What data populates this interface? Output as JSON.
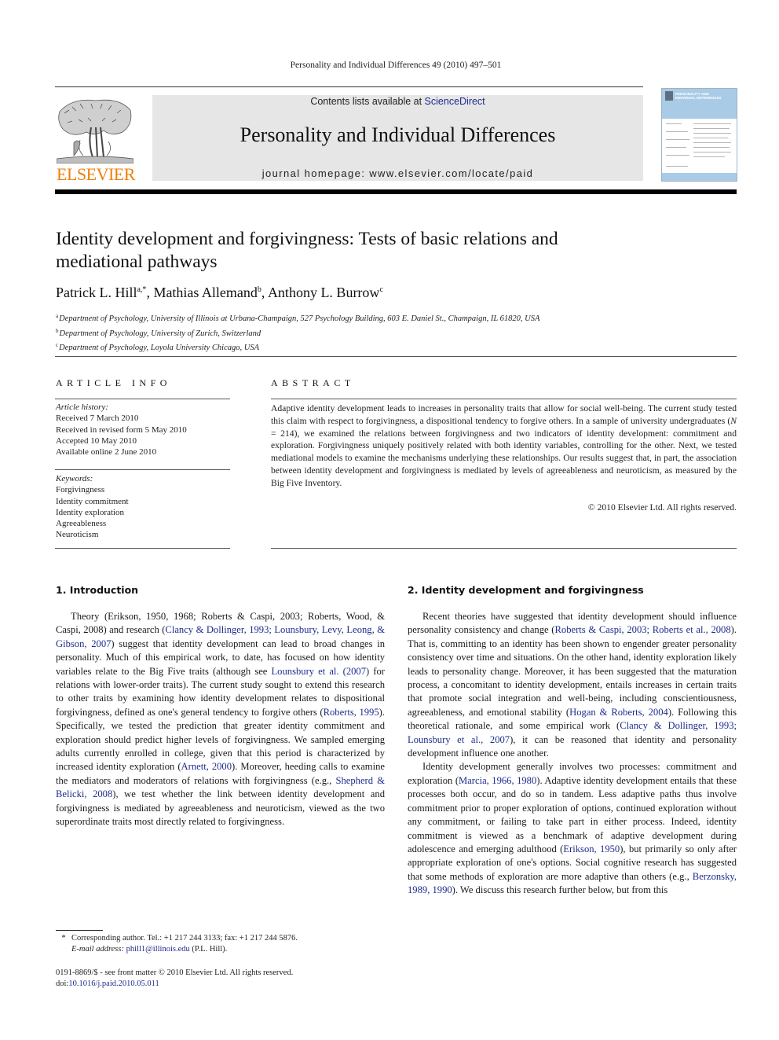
{
  "header": {
    "journal_reference": "Personality and Individual Differences 49 (2010) 497–501",
    "contents_prefix": "Contents lists available at ",
    "contents_link": "ScienceDirect",
    "journal_title": "Personality and Individual Differences",
    "homepage": "journal homepage: www.elsevier.com/locate/paid",
    "publisher_logo_text": "ELSEVIER",
    "cover_title_line1": "PERSONALITY AND",
    "cover_title_line2": "INDIVIDUAL DIFFERENCES"
  },
  "article": {
    "title": "Identity development and forgivingness: Tests of basic relations and mediational pathways",
    "authors": [
      {
        "name": "Patrick L. Hill",
        "marks": "a,*"
      },
      {
        "name": "Mathias Allemand",
        "marks": "b"
      },
      {
        "name": "Anthony L. Burrow",
        "marks": "c"
      }
    ],
    "affiliations": [
      {
        "mark": "a",
        "text": "Department of Psychology, University of Illinois at Urbana-Champaign, 527 Psychology Building, 603 E. Daniel St., Champaign, IL 61820, USA"
      },
      {
        "mark": "b",
        "text": "Department of Psychology, University of Zurich, Switzerland"
      },
      {
        "mark": "c",
        "text": "Department of Psychology, Loyola University Chicago, USA"
      }
    ]
  },
  "article_info": {
    "heading": "ARTICLE INFO",
    "history_label": "Article history:",
    "history": [
      "Received 7 March 2010",
      "Received in revised form 5 May 2010",
      "Accepted 10 May 2010",
      "Available online 2 June 2010"
    ],
    "keywords_label": "Keywords:",
    "keywords": [
      "Forgivingness",
      "Identity commitment",
      "Identity exploration",
      "Agreeableness",
      "Neuroticism"
    ]
  },
  "abstract": {
    "heading": "ABSTRACT",
    "text_1": "Adaptive identity development leads to increases in personality traits that allow for social well-being. The current study tested this claim with respect to forgivingness, a dispositional tendency to forgive others. In a sample of university undergraduates (",
    "n_label": "N",
    "text_2": " = 214), we examined the relations between forgivingness and two indicators of identity development: commitment and exploration. Forgivingness uniquely positively related with both identity variables, controlling for the other. Next, we tested mediational models to examine the mechanisms underlying these relationships. Our results suggest that, in part, the association between identity development and forgivingness is mediated by levels of agreeableness and neuroticism, as measured by the Big Five Inventory.",
    "copyright": "© 2010 Elsevier Ltd. All rights reserved."
  },
  "sections": {
    "intro": {
      "heading": "1. Introduction",
      "p1": [
        {
          "t": "Theory (Erikson, 1950, 1968; Roberts & Caspi, 2003; Roberts, Wood, & Caspi, 2008) and research ("
        },
        {
          "t": "Clancy & Dollinger, 1993; Lounsbury, Levy, Leong, & Gibson, 2007",
          "cite": true
        },
        {
          "t": ") suggest that identity development can lead to broad changes in personality. Much of this empirical work, to date, has focused on how identity variables relate to the Big Five traits (although see "
        },
        {
          "t": "Lounsbury et al. (2007)",
          "cite": true
        },
        {
          "t": " for relations with lower-order traits). The current study sought to extend this research to other traits by examining how identity development relates to dispositional forgivingness, defined as one's general tendency to forgive others ("
        },
        {
          "t": "Roberts, 1995",
          "cite": true
        },
        {
          "t": "). Specifically, we tested the prediction that greater identity commitment and exploration should predict higher levels of forgivingness. We sampled emerging adults currently enrolled in college, given that this period is characterized by increased identity exploration ("
        },
        {
          "t": "Arnett, 2000",
          "cite": true
        },
        {
          "t": "). Moreover, heeding calls to examine the mediators and moderators of relations with forgivingness (e.g., "
        },
        {
          "t": "Shepherd & Belicki, 2008",
          "cite": true
        },
        {
          "t": "), we test whether the link between identity development and forgivingness is mediated by agreeableness and neuroticism, viewed as the two superordinate traits most directly related to forgivingness."
        }
      ]
    },
    "identity": {
      "heading": "2. Identity development and forgivingness",
      "p1": [
        {
          "t": "Recent theories have suggested that identity development should influence personality consistency and change ("
        },
        {
          "t": "Roberts & Caspi, 2003; Roberts et al., 2008",
          "cite": true
        },
        {
          "t": "). That is, committing to an identity has been shown to engender greater personality consistency over time and situations. On the other hand, identity exploration likely leads to personality change. Moreover, it has been suggested that the maturation process, a concomitant to identity development, entails increases in certain traits that promote social integration and well-being, including conscientiousness, agreeableness, and emotional stability ("
        },
        {
          "t": "Hogan & Roberts, 2004",
          "cite": true
        },
        {
          "t": "). Following this theoretical rationale, and some empirical work ("
        },
        {
          "t": "Clancy & Dollinger, 1993; Lounsbury et al., 2007",
          "cite": true
        },
        {
          "t": "), it can be reasoned that identity and personality development influence one another."
        }
      ],
      "p2": [
        {
          "t": "Identity development generally involves two processes: commitment and exploration ("
        },
        {
          "t": "Marcia, 1966, 1980",
          "cite": true
        },
        {
          "t": "). Adaptive identity development entails that these processes both occur, and do so in tandem. Less adaptive paths thus involve commitment prior to proper exploration of options, continued exploration without any commitment, or failing to take part in either process. Indeed, identity commitment is viewed as a benchmark of adaptive development during adolescence and emerging adulthood ("
        },
        {
          "t": "Erikson, 1950",
          "cite": true
        },
        {
          "t": "), but primarily so only after appropriate exploration of one's options. Social cognitive research has suggested that some methods of exploration are more adaptive than others (e.g., "
        },
        {
          "t": "Berzonsky, 1989, 1990",
          "cite": true
        },
        {
          "t": "). We discuss this research further below, but from this"
        }
      ]
    }
  },
  "footnote": {
    "star": "*",
    "corresponding": "Corresponding author. Tel.: +1 217 244 3133; fax: +1 217 244 5876.",
    "email_label": "E-mail address: ",
    "email": "phill1@illinois.edu",
    "email_suffix": " (P.L. Hill)."
  },
  "issn": {
    "line1": "0191-8869/$ - see front matter © 2010 Elsevier Ltd. All rights reserved.",
    "doi_prefix": "doi:",
    "doi": "10.1016/j.paid.2010.05.011"
  },
  "colors": {
    "link": "#1e2c8c",
    "elsevier_orange": "#f07f09",
    "banner_bg": "#e6e6e6",
    "cover_blue": "#a9cbe6"
  }
}
